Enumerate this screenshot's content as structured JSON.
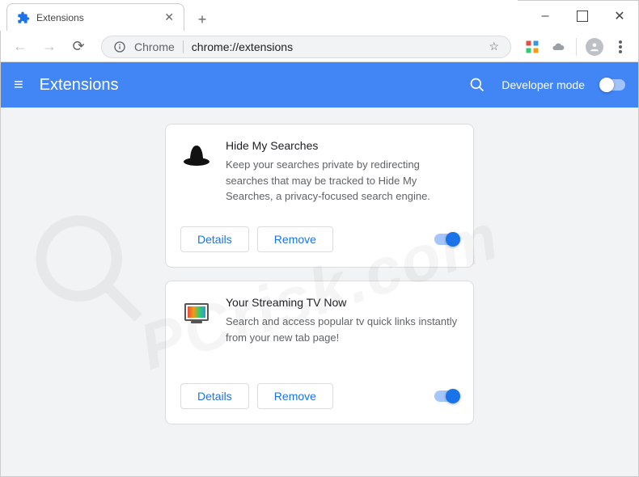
{
  "window": {
    "min": "–",
    "max": "☐",
    "close": "✕"
  },
  "tab": {
    "title": "Extensions",
    "close": "✕",
    "newtab": "+"
  },
  "toolbar": {
    "back": "←",
    "forward": "→",
    "reload": "⟳",
    "scheme_label": "Chrome",
    "url_path": "chrome://extensions",
    "star": "☆"
  },
  "header": {
    "menu_glyph": "≡",
    "title": "Extensions",
    "search_glyph": "🔍",
    "dev_mode": "Developer mode"
  },
  "buttons": {
    "details": "Details",
    "remove": "Remove"
  },
  "extensions": [
    {
      "name": "Hide My Searches",
      "desc": "Keep your searches private by redirecting searches that may be tracked to Hide My Searches, a privacy-focused search engine.",
      "icon": "hat",
      "enabled": true
    },
    {
      "name": "Your Streaming TV Now",
      "desc": "Search and access popular tv quick links instantly from your new tab page!",
      "icon": "tv",
      "enabled": true
    }
  ],
  "watermark": "PCrisk.com"
}
